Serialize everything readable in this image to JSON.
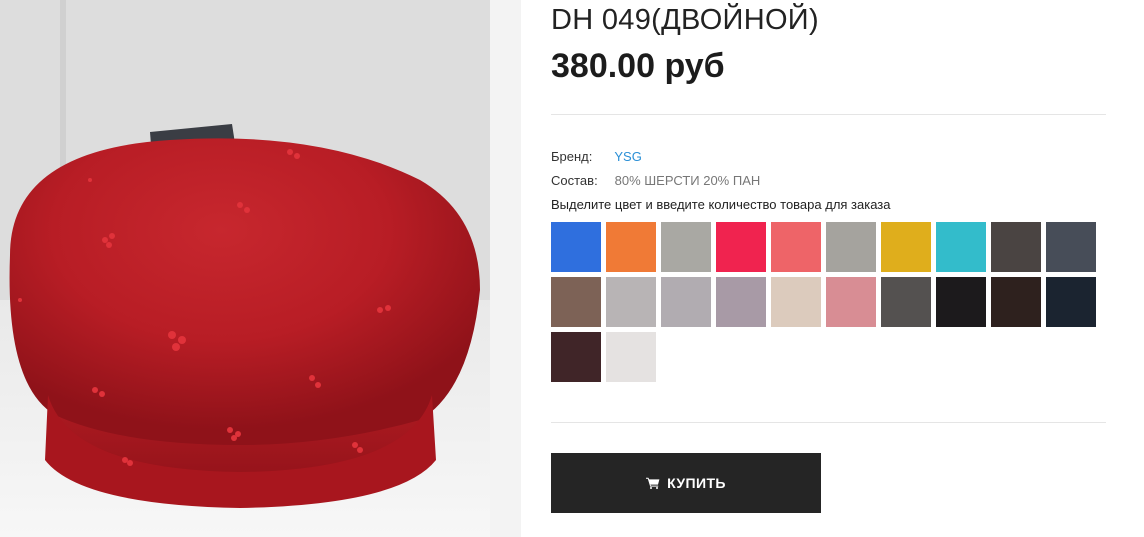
{
  "product": {
    "title": "DH 049(ДВОЙНОЙ)",
    "price": "380.00 руб",
    "image_alt": "Красный берет со стразами"
  },
  "attributes": {
    "brand_label": "Бренд:",
    "brand_value": "YSG",
    "composition_label": "Состав:",
    "composition_value": "80% ШЕРСТИ 20% ПАН"
  },
  "color_hint": "Выделите цвет и введите количество товара для заказа",
  "swatches": [
    "#2f6fde",
    "#f07a36",
    "#a9a8a3",
    "#f0234f",
    "#ee6468",
    "#a5a39e",
    "#dfae1c",
    "#33bccb",
    "#4a4442",
    "#474d58",
    "#7d6256",
    "#b8b4b5",
    "#b1acb1",
    "#a89aa6",
    "#dccbbd",
    "#d88d94",
    "#545150",
    "#1c1a1c",
    "#2e211e",
    "#1b2430",
    "#402528",
    "#e5e2e1"
  ],
  "buy_button": {
    "label": "КУПИТЬ",
    "icon": "cart-icon"
  }
}
